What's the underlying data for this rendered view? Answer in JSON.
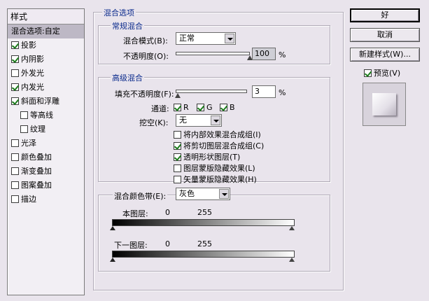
{
  "styles_panel": {
    "header": "样式",
    "items": [
      {
        "label": "混合选项:自定",
        "checkbox": false,
        "checked": false,
        "sub": false,
        "selected": true
      },
      {
        "label": "投影",
        "checkbox": true,
        "checked": true,
        "sub": false,
        "selected": false
      },
      {
        "label": "内阴影",
        "checkbox": true,
        "checked": true,
        "sub": false,
        "selected": false
      },
      {
        "label": "外发光",
        "checkbox": true,
        "checked": false,
        "sub": false,
        "selected": false
      },
      {
        "label": "内发光",
        "checkbox": true,
        "checked": true,
        "sub": false,
        "selected": false
      },
      {
        "label": "斜面和浮雕",
        "checkbox": true,
        "checked": true,
        "sub": false,
        "selected": false
      },
      {
        "label": "等高线",
        "checkbox": true,
        "checked": false,
        "sub": true,
        "selected": false
      },
      {
        "label": "纹理",
        "checkbox": true,
        "checked": false,
        "sub": true,
        "selected": false
      },
      {
        "label": "光泽",
        "checkbox": true,
        "checked": false,
        "sub": false,
        "selected": false
      },
      {
        "label": "颜色叠加",
        "checkbox": true,
        "checked": false,
        "sub": false,
        "selected": false
      },
      {
        "label": "渐变叠加",
        "checkbox": true,
        "checked": false,
        "sub": false,
        "selected": false
      },
      {
        "label": "图案叠加",
        "checkbox": true,
        "checked": false,
        "sub": false,
        "selected": false
      },
      {
        "label": "描边",
        "checkbox": true,
        "checked": false,
        "sub": false,
        "selected": false
      }
    ]
  },
  "blend_options": {
    "title": "混合选项",
    "general": {
      "title": "常规混合",
      "mode_label": "混合模式(B):",
      "mode_value": "正常",
      "opacity_label": "不透明度(O):",
      "opacity_value": "100",
      "opacity_unit": "%",
      "opacity_fraction": 1.0
    },
    "advanced": {
      "title": "高级混合",
      "fill_label": "填充不透明度(F):",
      "fill_value": "3",
      "fill_unit": "%",
      "fill_fraction": 0.03,
      "channels_label": "通道:",
      "channels": [
        {
          "label": "R",
          "checked": true
        },
        {
          "label": "G",
          "checked": true
        },
        {
          "label": "B",
          "checked": true
        }
      ],
      "knockout_label": "挖空(K):",
      "knockout_value": "无",
      "options": [
        {
          "label": "将内部效果混合成组(I)",
          "checked": false
        },
        {
          "label": "将剪切图层混合成组(C)",
          "checked": true
        },
        {
          "label": "透明形状图层(T)",
          "checked": true
        },
        {
          "label": "图层蒙版隐藏效果(L)",
          "checked": false
        },
        {
          "label": "矢量蒙版隐藏效果(H)",
          "checked": false
        }
      ]
    },
    "blend_if": {
      "label": "混合颜色带(E):",
      "value": "灰色",
      "this_layer_label": "本图层:",
      "this_layer_min": "0",
      "this_layer_max": "255",
      "underlying_label": "下一图层:",
      "underlying_min": "0",
      "underlying_max": "255"
    }
  },
  "buttons": {
    "ok": "好",
    "cancel": "取消",
    "new_style": "新建样式(W)...",
    "preview_label": "预览(V)",
    "preview_checked": true
  }
}
